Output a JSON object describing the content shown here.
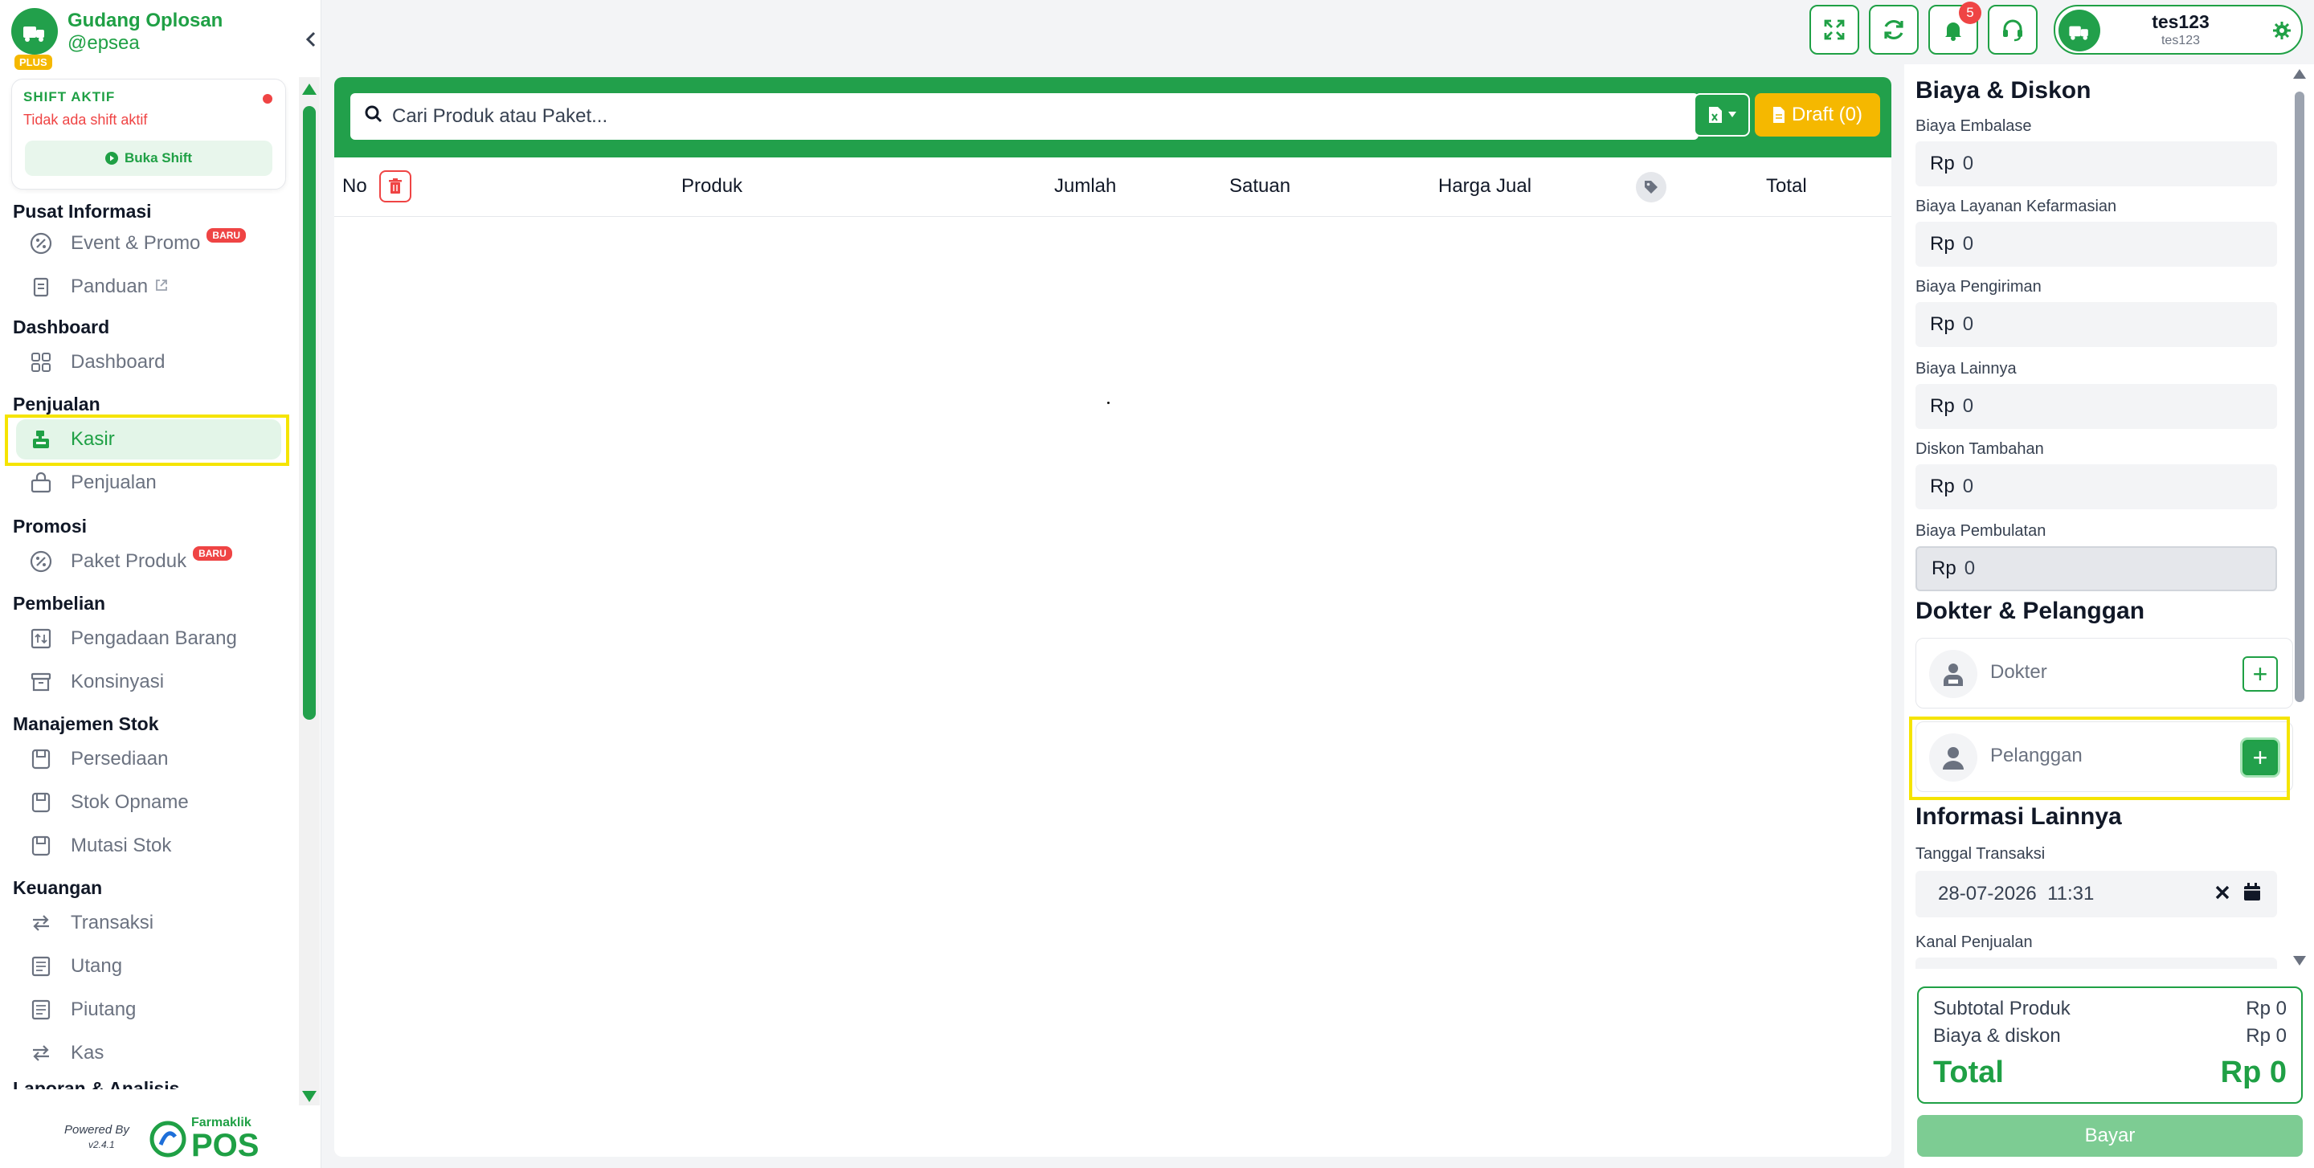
{
  "brand": {
    "name": "Gudang Oplosan",
    "handle": "@epsea",
    "plan_badge": "PLUS"
  },
  "shift": {
    "title": "SHIFT AKTIF",
    "status": "Tidak ada shift aktif",
    "button_label": "Buka Shift"
  },
  "sidebar": {
    "sections": {
      "pusat_informasi": "Pusat Informasi",
      "dashboard": "Dashboard",
      "penjualan": "Penjualan",
      "promosi": "Promosi",
      "pembelian": "Pembelian",
      "manajemen_stok": "Manajemen Stok",
      "keuangan": "Keuangan",
      "laporan": "Laporan & Analisis"
    },
    "items": {
      "event_promo": "Event & Promo",
      "panduan": "Panduan",
      "dashboard": "Dashboard",
      "kasir": "Kasir",
      "penjualan": "Penjualan",
      "paket_produk": "Paket Produk",
      "pengadaan_barang": "Pengadaan Barang",
      "konsinyasi": "Konsinyasi",
      "persediaan": "Persediaan",
      "stok_opname": "Stok Opname",
      "mutasi_stok": "Mutasi Stok",
      "transaksi": "Transaksi",
      "utang": "Utang",
      "piutang": "Piutang",
      "kas": "Kas"
    },
    "new_badge": "BARU",
    "active_item": "kasir"
  },
  "footer": {
    "powered_by": "Powered By",
    "version": "v2.4.1",
    "logo_small": "Farmaklik",
    "logo_big": "POS"
  },
  "topbar": {
    "notification_count": "5",
    "user_name": "tes123",
    "user_sub": "tes123"
  },
  "search": {
    "placeholder": "Cari Produk atau Paket...",
    "draft_label": "Draft (0)"
  },
  "table": {
    "columns": {
      "no": "No",
      "produk": "Produk",
      "jumlah": "Jumlah",
      "satuan": "Satuan",
      "harga_jual": "Harga Jual",
      "total": "Total"
    }
  },
  "biaya": {
    "heading": "Biaya & Diskon",
    "currency": "Rp",
    "fields": [
      {
        "label": "Biaya Embalase",
        "value": "0"
      },
      {
        "label": "Biaya Layanan Kefarmasian",
        "value": "0"
      },
      {
        "label": "Biaya Pengiriman",
        "value": "0"
      },
      {
        "label": "Biaya Lainnya",
        "value": "0"
      },
      {
        "label": "Diskon Tambahan",
        "value": "0"
      },
      {
        "label": "Biaya Pembulatan",
        "value": "0"
      }
    ]
  },
  "dokter_pelanggan": {
    "heading": "Dokter & Pelanggan",
    "dokter_label": "Dokter",
    "pelanggan_label": "Pelanggan"
  },
  "info_lainnya": {
    "heading": "Informasi Lainnya",
    "tanggal_label": "Tanggal Transaksi",
    "tanggal_value": "28-07-2026  11:31",
    "kanal_label": "Kanal Penjualan"
  },
  "summary": {
    "subtotal_label": "Subtotal Produk",
    "subtotal_value": "Rp 0",
    "biaya_label": "Biaya & diskon",
    "biaya_value": "Rp 0",
    "total_label": "Total",
    "total_value": "Rp 0",
    "pay_button": "Bayar"
  },
  "colors": {
    "primary": "#22a04b",
    "accent": "#f5b800",
    "danger": "#ef4444",
    "highlight": "#f5e400"
  }
}
